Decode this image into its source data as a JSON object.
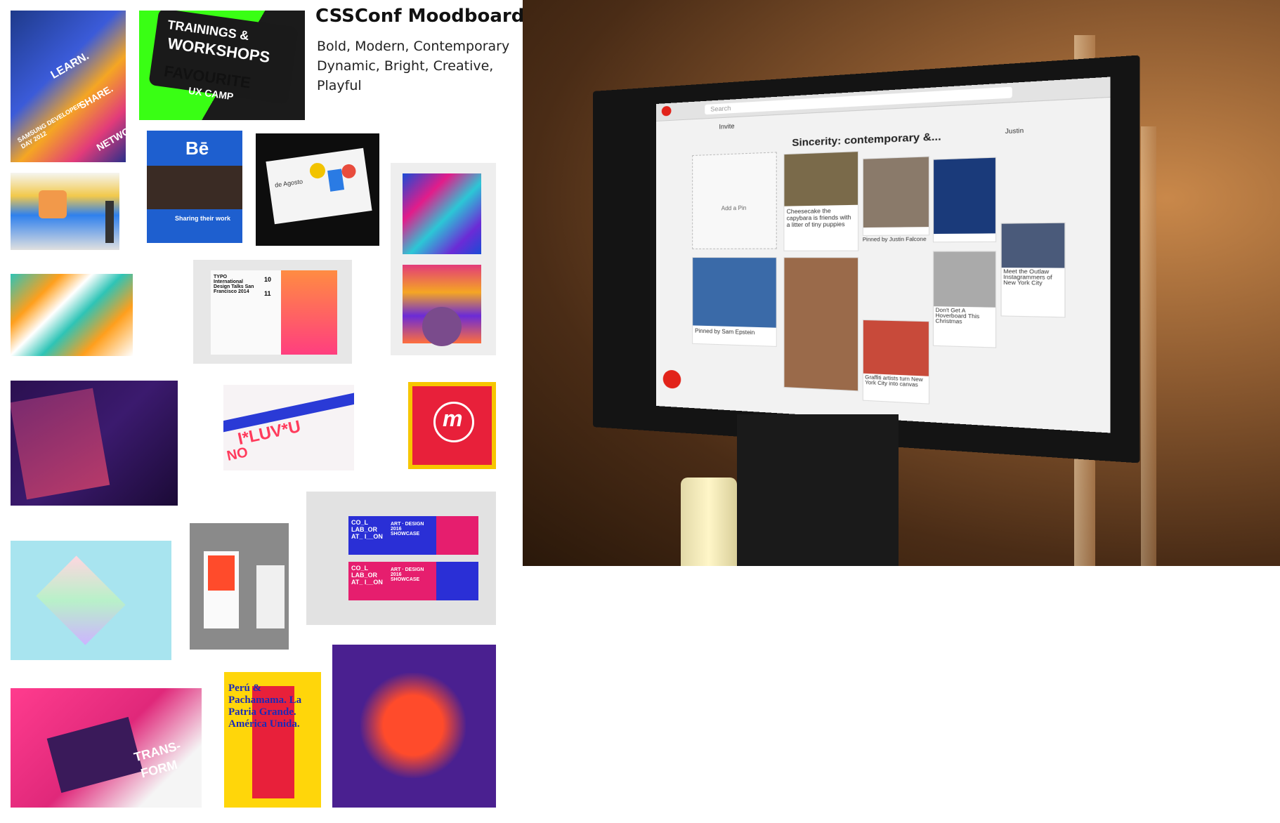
{
  "moodboard": {
    "title": "CSSConf Moodboard",
    "keywords": [
      "Bold, Modern, Contemporary",
      "Dynamic, Bright, Creative,",
      "Playful"
    ]
  },
  "thumbnails": {
    "samsung": [
      "LEARN.",
      "SHARE.",
      "NETWO",
      "SAMSUNG DEVELOPER DAY 2012"
    ],
    "workshops": [
      "TRAININGS &",
      "WORKSHOPS",
      "FAVOURITE",
      "UX CAMP"
    ],
    "behance": [
      "Bē",
      "Sharing their work"
    ],
    "card": [
      "de Agosto"
    ],
    "typo": [
      "TYPO International Design Talks San Francisco 2014",
      "10",
      "11"
    ],
    "luv": [
      "I*LUV*U",
      "NO"
    ],
    "collab": [
      "CO_L LAB_OR AT_ I__ON",
      "ART · DESIGN 2016 SHOWCASE"
    ],
    "peru": [
      "Perú & Pachamama. La Patria Grande. América Unida."
    ],
    "transform": [
      "TRANS-",
      "FORM"
    ]
  },
  "tv_screen": {
    "search_placeholder": "Search",
    "invite": "Invite",
    "board_title": "Sincerity: contemporary &...",
    "user": "Justin",
    "add_pin": "Add a Pin",
    "pins": [
      "Cheesecake the capybara is friends with a litter of tiny puppies",
      "Pinned by Sam Epstein",
      "Pinned by Justin Falcone",
      "Don't Get A Hoverboard This Christmas",
      "Meet the Outlaw Instagrammers of New York City",
      "Graffiti artists turn New York City into canvas"
    ]
  },
  "colors": {
    "accent": "#e2231a",
    "neon_green": "#39ff14",
    "purple": "#3b1a6e"
  }
}
